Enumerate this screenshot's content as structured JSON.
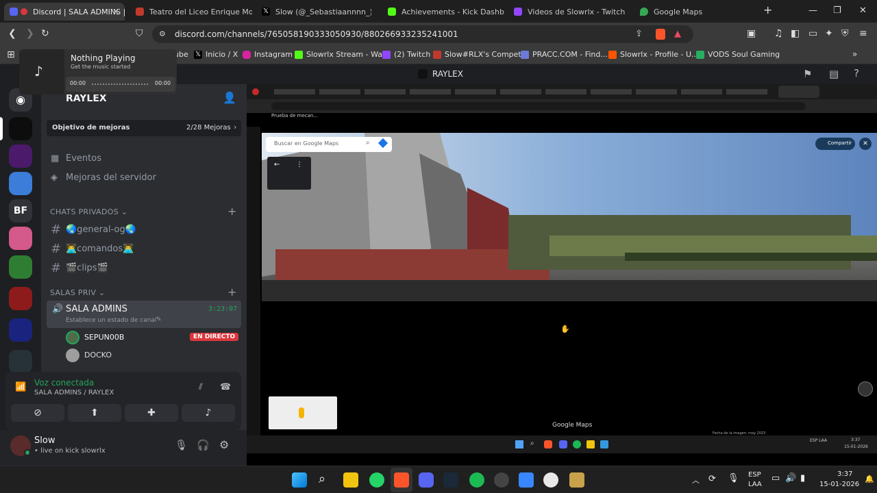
{
  "browser": {
    "tabs": [
      {
        "title": "Discord | SALA ADMINS |",
        "active": true
      },
      {
        "title": "Teatro del Liceo Enrique Molina"
      },
      {
        "title": "Slow (@_Sebastiaannnn_) / X"
      },
      {
        "title": "Achievements - Kick Dashboard"
      },
      {
        "title": "Videos de Slowrlx - Twitch"
      },
      {
        "title": "Google Maps"
      }
    ],
    "new_tab": "+",
    "url": "discord.com/channels/765058190333050930/880266933235241001",
    "bookmarks": [
      {
        "label": "ube"
      },
      {
        "label": "Inicio / X"
      },
      {
        "label": "Instagram"
      },
      {
        "label": "Slowrlx Stream - Wa..."
      },
      {
        "label": "(2) Twitch"
      },
      {
        "label": "Slow#RLX's Compet..."
      },
      {
        "label": "PRACC.COM - Find..."
      },
      {
        "label": "Slowrlx - Profile - U..."
      },
      {
        "label": "VODS Soul Gaming"
      }
    ]
  },
  "music_popup": {
    "title": "Nothing Playing",
    "subtitle": "Get the music started",
    "time_start": "00:00",
    "time_end": "00:00"
  },
  "discord": {
    "top_title": "RAYLEX",
    "server_name": "RAYLEX",
    "server_initials": "BF",
    "boost_goal": {
      "label": "Objetivo de mejoras",
      "progress": "2/28 Mejoras"
    },
    "links": [
      {
        "label": "Eventos"
      },
      {
        "label": "Mejoras del servidor"
      }
    ],
    "private_section": "CHATS PRIVADOS",
    "text_channels": [
      {
        "name": "🌏general-og🌏"
      },
      {
        "name": "👨‍💻comandos👨‍💻"
      },
      {
        "name": "🎬clips🎬"
      }
    ],
    "voice_section": "SALAS PRIV",
    "voice_channel": {
      "name": "SALA ADMINS",
      "timer": "3:23:07",
      "status_prompt": "Establece un estado de canal"
    },
    "voice_users": [
      {
        "name": "SEPUN00B",
        "badge": "EN DIRECTO"
      },
      {
        "name": "DOCKO"
      }
    ],
    "voice_connection": {
      "status": "Voz conectada",
      "location": "SALA ADMINS / RAYLEX"
    },
    "user": {
      "name": "Slow",
      "activity": "• live on kick slowrlx"
    }
  },
  "stream": {
    "inner_search_placeholder": "Buscar en Google Maps",
    "share_label": "Compartir",
    "inner_title": "Prueba de mecan...",
    "google_maps_logo": "Google Maps",
    "inner_footer": "Fecha de la imagen: may 2023",
    "inner_clock": "3:37",
    "inner_date": "15-01-2026",
    "inner_lang": "ESP LAA"
  },
  "taskbar": {
    "lang_top": "ESP",
    "lang_bottom": "LAA",
    "time": "3:37",
    "date": "15-01-2026"
  },
  "colors": {
    "discord_green": "#23a55a",
    "live_red": "#da373c",
    "brave_orange": "#fb542b"
  }
}
